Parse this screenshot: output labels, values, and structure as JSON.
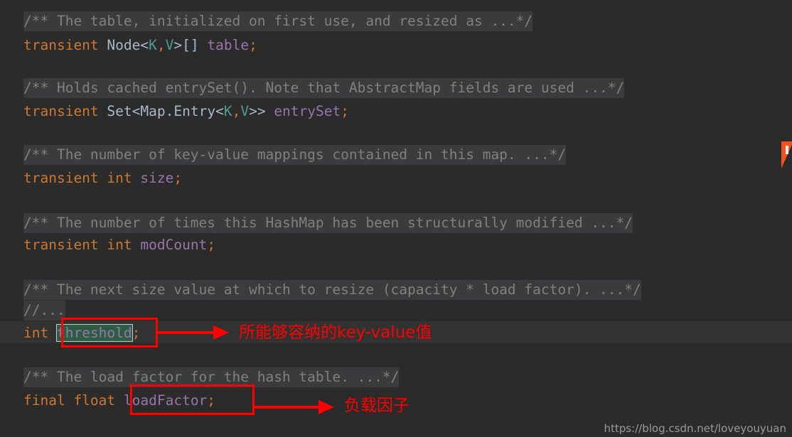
{
  "editor": {
    "background_color": "#2b2b2b",
    "current_line_color": "#323232",
    "folded_comment_color": "#3b3b3d",
    "lines": [
      {
        "indent": "  ",
        "comment": "/** The table, initialized on first use, and resized as ...*/"
      },
      {
        "kw1": "transient",
        "type": "Node",
        "lt": "<",
        "k": "K",
        "comma": ",",
        "v": "V",
        "gt": ">",
        "brackets": "[]",
        "field": "table",
        "semi": ";"
      },
      {
        "indent": "  ",
        "comment": "/** Holds cached entrySet(). Note that AbstractMap fields are used ...*/"
      },
      {
        "kw1": "transient",
        "type": "Set",
        "lt": "<",
        "inner": "Map.Entry",
        "lt2": "<",
        "k": "K",
        "comma": ",",
        "v": "V",
        "gt": ">>",
        "field": "entrySet",
        "semi": ";"
      },
      {
        "indent": "  ",
        "comment": "/** The number of key-value mappings contained in this map. ...*/"
      },
      {
        "kw1": "transient",
        "kw2": "int",
        "field": "size",
        "semi": ";"
      },
      {
        "indent": "  ",
        "comment": "/** The number of times this HashMap has been structurally modified ...*/"
      },
      {
        "kw1": "transient",
        "kw2": "int",
        "field": "modCount",
        "semi": ";"
      },
      {
        "indent": "  ",
        "comment": "/** The next size value at which to resize (capacity * load factor). ...*/"
      },
      {
        "indent": "  ",
        "comment": "//..."
      },
      {
        "kw1": "int",
        "field": "threshold",
        "semi": ";",
        "selected": true
      },
      {
        "indent": "  ",
        "comment": "/** The load factor for the hash table. ...*/"
      },
      {
        "kw1": "final",
        "kw2": "float",
        "field": "loadFactor",
        "semi": ";"
      }
    ],
    "tokens": {
      "l1_comment": "/** The table, initialized on first use, and resized as ...*/",
      "l2_kw": "transient",
      "l2_type": "Node",
      "l2_lt": "<",
      "l2_k": "K",
      "l2_comma": ",",
      "l2_v": "V",
      "l2_gt": ">",
      "l2_brackets": "[]",
      "l2_field": " table",
      "l2_semi": ";",
      "l3_comment": "/** Holds cached entrySet(). Note that AbstractMap fields are used ...*/",
      "l4_kw": "transient",
      "l4_type": "Set",
      "l4_lt": "<",
      "l4_inner": "Map.Entry",
      "l4_lt2": "<",
      "l4_k": "K",
      "l4_comma": ",",
      "l4_v": "V",
      "l4_gt": ">>",
      "l4_field": " entrySet",
      "l4_semi": ";",
      "l5_comment": "/** The number of key-value mappings contained in this map. ...*/",
      "l6_kw1": "transient",
      "l6_kw2": " int",
      "l6_field": " size",
      "l6_semi": ";",
      "l7_comment": "/** The number of times this HashMap has been structurally modified ...*/",
      "l8_kw1": "transient",
      "l8_kw2": " int",
      "l8_field": " modCount",
      "l8_semi": ";",
      "l9_comment": "/** The next size value at which to resize (capacity * load factor). ...*/",
      "l10_comment": "//...",
      "l11_kw": "int",
      "l11_field": "threshold",
      "l11_semi": ";",
      "l12_comment": "/** The load factor for the hash table. ...*/",
      "l13_kw1": "final",
      "l13_kw2": " float",
      "l13_field": " loadFactor",
      "l13_semi": ";"
    }
  },
  "annotations": [
    {
      "id": "threshold-annotation",
      "label": "所能够容纳的key-value值",
      "color": "#ff0000",
      "target": "threshold"
    },
    {
      "id": "loadfactor-annotation",
      "label": "负载因子",
      "color": "#ff0000",
      "target": "loadFactor"
    }
  ],
  "annotation_text": {
    "threshold": "所能够容纳的key-value值",
    "loadfactor": "负载因子"
  },
  "watermark": {
    "url": "https://blog.csdn.net/loveyouyuan"
  },
  "colors": {
    "keyword": "#cc7832",
    "field": "#9876aa",
    "type": "#a9b7c6",
    "generic": "#4e9a91",
    "comment": "#808080",
    "selection": "#2e5d45",
    "annotation_red": "#ff0000",
    "marker_orange": "#f4511e"
  }
}
